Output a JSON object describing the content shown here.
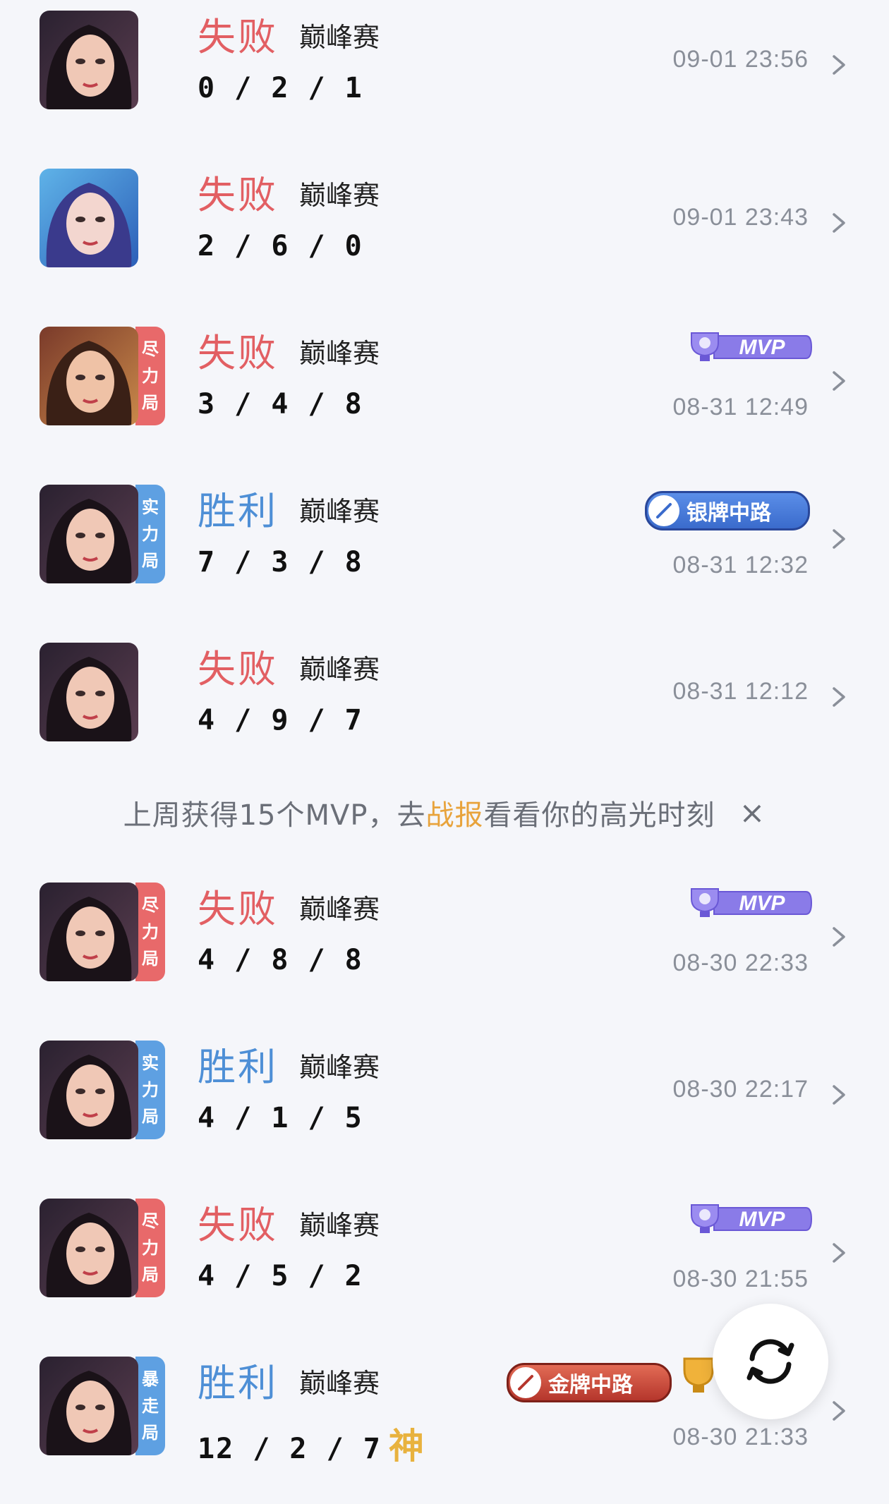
{
  "matches": [
    {
      "result": "失败",
      "kind": "lose",
      "mode": "巅峰赛",
      "kda": "0 / 2 / 1",
      "time": "09-01 23:56",
      "tag": null,
      "badge": null,
      "avatar": "dark"
    },
    {
      "result": "失败",
      "kind": "lose",
      "mode": "巅峰赛",
      "kda": "2 / 6 / 0",
      "time": "09-01 23:43",
      "tag": null,
      "badge": null,
      "avatar": "blue"
    },
    {
      "result": "失败",
      "kind": "lose",
      "mode": "巅峰赛",
      "kda": "3 / 4 / 8",
      "time": "08-31 12:49",
      "tag": [
        "尽",
        "力",
        "局"
      ],
      "tagColor": "red",
      "badge": "MVP",
      "avatar": "gold"
    },
    {
      "result": "胜利",
      "kind": "win",
      "mode": "巅峰赛",
      "kda": "7 / 3 / 8",
      "time": "08-31 12:32",
      "tag": [
        "实",
        "力",
        "局"
      ],
      "tagColor": "blue",
      "badge": "银牌中路",
      "avatar": "dark"
    },
    {
      "result": "失败",
      "kind": "lose",
      "mode": "巅峰赛",
      "kda": "4 / 9 / 7",
      "time": "08-31 12:12",
      "tag": null,
      "badge": null,
      "avatar": "dark"
    },
    {
      "result": "失败",
      "kind": "lose",
      "mode": "巅峰赛",
      "kda": "4 / 8 / 8",
      "time": "08-30 22:33",
      "tag": [
        "尽",
        "力",
        "局"
      ],
      "tagColor": "red",
      "badge": "MVP",
      "avatar": "dark"
    },
    {
      "result": "胜利",
      "kind": "win",
      "mode": "巅峰赛",
      "kda": "4 / 1 / 5",
      "time": "08-30 22:17",
      "tag": [
        "实",
        "力",
        "局"
      ],
      "tagColor": "blue",
      "badge": null,
      "avatar": "dark"
    },
    {
      "result": "失败",
      "kind": "lose",
      "mode": "巅峰赛",
      "kda": "4 / 5 / 2",
      "time": "08-30 21:55",
      "tag": [
        "尽",
        "力",
        "局"
      ],
      "tagColor": "red",
      "badge": "MVP",
      "avatar": "dark"
    },
    {
      "result": "胜利",
      "kind": "win",
      "mode": "巅峰赛",
      "kda": "12 / 2 / 7",
      "time": "08-30 21:33",
      "tag": [
        "暴",
        "走",
        "局"
      ],
      "tagColor": "blue",
      "badge": "金牌中路",
      "avatar": "dark",
      "extra": "神"
    }
  ],
  "notice": {
    "before": "上周获得15个MVP，去",
    "link": "战报",
    "after": "看看你的高光时刻",
    "close": "×"
  },
  "colors": {
    "lose": "#e25f63",
    "win": "#4e8fd6",
    "link": "#e8a33c"
  }
}
